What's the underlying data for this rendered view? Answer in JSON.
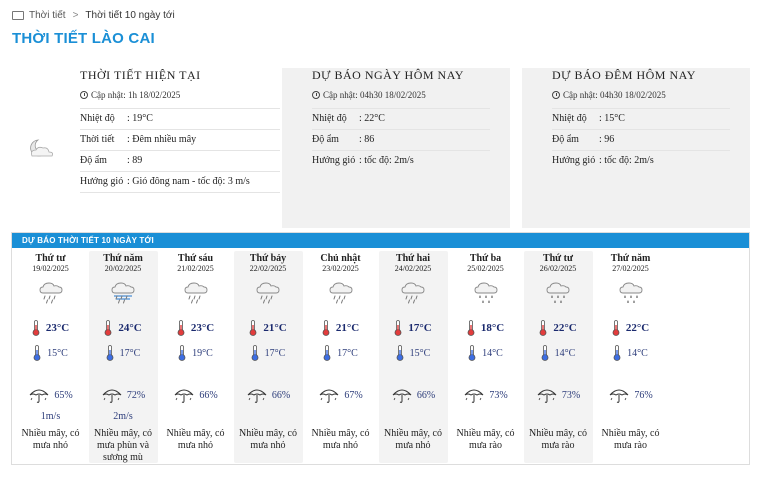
{
  "breadcrumb": {
    "home": "Thời tiết",
    "sep": ">",
    "current": "Thời tiết 10 ngày tới"
  },
  "page_title": "THỜI TIẾT LÀO CAI",
  "current": {
    "title": "THỜI TIẾT HIỆN TẠI",
    "updated": "Cập nhật: 1h 18/02/2025",
    "icon": "partly-cloudy-night-icon",
    "rows": [
      {
        "label": "Nhiệt độ",
        "value": ": 19°C"
      },
      {
        "label": "Thời tiết",
        "value": ": Đêm nhiều mây"
      },
      {
        "label": "Độ ẩm",
        "value": ": 89"
      },
      {
        "label": "Hướng gió",
        "value": ": Gió đông nam - tốc độ: 3 m/s"
      }
    ]
  },
  "today": {
    "title": "DỰ BÁO NGÀY HÔM NAY",
    "updated": "Cập nhật: 04h30 18/02/2025",
    "rows": [
      {
        "label": "Nhiệt độ",
        "value": ": 22°C"
      },
      {
        "label": "Độ ẩm",
        "value": ": 86"
      },
      {
        "label": "Hướng gió",
        "value": ": tốc độ: 2m/s"
      }
    ]
  },
  "tonight": {
    "title": "DỰ BÁO ĐÊM HÔM NAY",
    "updated": "Cập nhật: 04h30 18/02/2025",
    "rows": [
      {
        "label": "Nhiệt độ",
        "value": ": 15°C"
      },
      {
        "label": "Độ ẩm",
        "value": ": 96"
      },
      {
        "label": "Hướng gió",
        "value": ": tốc độ: 2m/s"
      }
    ]
  },
  "forecast": {
    "title": "DỰ BÁO THỜI TIẾT 10 NGÀY TỚI",
    "days": [
      {
        "name": "Thứ tư",
        "date": "19/02/2025",
        "icon": "rain-cloud-icon",
        "hi": "23°C",
        "lo": "15°C",
        "rain": "65%",
        "wind": "1m/s",
        "desc": "Nhiều mây, có mưa nhỏ"
      },
      {
        "name": "Thứ năm",
        "date": "20/02/2025",
        "icon": "fog-rain-icon",
        "hi": "24°C",
        "lo": "17°C",
        "rain": "72%",
        "wind": "2m/s",
        "desc": "Nhiều mây, có mưa phùn và sương mù"
      },
      {
        "name": "Thứ sáu",
        "date": "21/02/2025",
        "icon": "rain-cloud-icon",
        "hi": "23°C",
        "lo": "19°C",
        "rain": "66%",
        "wind": "",
        "desc": "Nhiều mây, có mưa nhỏ"
      },
      {
        "name": "Thứ bảy",
        "date": "22/02/2025",
        "icon": "rain-cloud-icon",
        "hi": "21°C",
        "lo": "17°C",
        "rain": "66%",
        "wind": "",
        "desc": "Nhiều mây, có mưa nhỏ"
      },
      {
        "name": "Chủ nhật",
        "date": "23/02/2025",
        "icon": "rain-cloud-icon",
        "hi": "21°C",
        "lo": "17°C",
        "rain": "67%",
        "wind": "",
        "desc": "Nhiều mây, có mưa nhỏ"
      },
      {
        "name": "Thứ hai",
        "date": "24/02/2025",
        "icon": "rain-cloud-icon",
        "hi": "17°C",
        "lo": "15°C",
        "rain": "66%",
        "wind": "",
        "desc": "Nhiều mây, có mưa nhỏ"
      },
      {
        "name": "Thứ ba",
        "date": "25/02/2025",
        "icon": "heavy-rain-cloud-icon",
        "hi": "18°C",
        "lo": "14°C",
        "rain": "73%",
        "wind": "",
        "desc": "Nhiều mây, có mưa rào"
      },
      {
        "name": "Thứ tư",
        "date": "26/02/2025",
        "icon": "heavy-rain-cloud-icon",
        "hi": "22°C",
        "lo": "14°C",
        "rain": "73%",
        "wind": "",
        "desc": "Nhiều mây, có mưa rào"
      },
      {
        "name": "Thứ năm",
        "date": "27/02/2025",
        "icon": "heavy-rain-cloud-icon",
        "hi": "22°C",
        "lo": "14°C",
        "rain": "76%",
        "wind": "",
        "desc": "Nhiều mây, có mưa rào"
      }
    ]
  },
  "colors": {
    "accent": "#1a8fd6",
    "text_dark_blue": "#1b2a6e",
    "panel_grey": "#f1f1f1"
  }
}
